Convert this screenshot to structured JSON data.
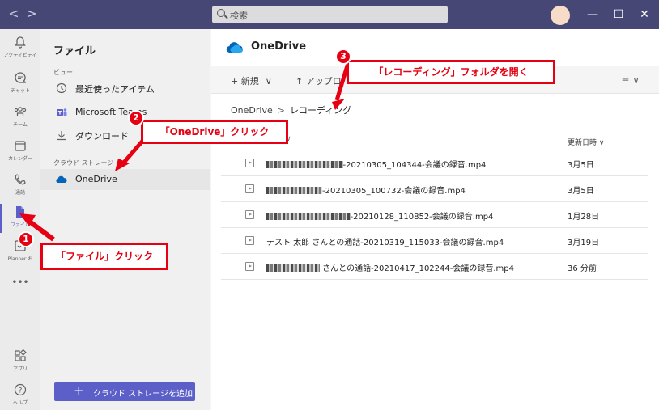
{
  "titlebar": {
    "back_label": "<",
    "forward_label": ">",
    "search_placeholder": "検索",
    "minimize_label": "—",
    "maximize_label": "☐",
    "close_label": "✕"
  },
  "rail": {
    "items": [
      {
        "label": "アクティビティ",
        "icon": "bell-icon"
      },
      {
        "label": "チャット",
        "icon": "chat-icon"
      },
      {
        "label": "チーム",
        "icon": "teams-icon"
      },
      {
        "label": "カレンダー",
        "icon": "calendar-icon"
      },
      {
        "label": "通話",
        "icon": "phone-icon"
      },
      {
        "label": "ファイル",
        "icon": "file-icon"
      },
      {
        "label": "Planner お",
        "icon": "planner-icon"
      },
      {
        "label": "•••",
        "icon": "more-icon"
      },
      {
        "label": "アプリ",
        "icon": "apps-icon"
      },
      {
        "label": "ヘルプ",
        "icon": "help-icon"
      }
    ],
    "active_index": 5
  },
  "files_panel": {
    "title": "ファイル",
    "view_section": "ビュー",
    "view_items": [
      {
        "label": "最近使ったアイテム",
        "icon": "clock-icon"
      },
      {
        "label": "Microsoft Teams",
        "icon": "teams-logo-icon"
      },
      {
        "label": "ダウンロード",
        "icon": "download-icon"
      }
    ],
    "cloud_section": "クラウド ストレージ",
    "cloud_items": [
      {
        "label": "OneDrive",
        "icon": "onedrive-icon"
      }
    ],
    "add_storage_label": "クラウド ストレージを追加"
  },
  "main": {
    "title": "OneDrive",
    "toolbar": {
      "new_label": "新規",
      "upload_label": "アップロ"
    },
    "breadcrumb": {
      "root": "OneDrive",
      "separator": ">",
      "current": "レコーディング"
    },
    "columns": {
      "type": "∨",
      "modified": "更新日時"
    },
    "files": [
      {
        "name": "-20210305_104344-会議の録音.mp4",
        "modified": "3月5日",
        "blur": 126
      },
      {
        "name": "-20210305_100732-会議の録音.mp4",
        "modified": "3月5日",
        "blur": 92
      },
      {
        "name": "-20210128_110852-会議の録音.mp4",
        "modified": "1月28日",
        "blur": 138
      },
      {
        "name": "テスト 太郎 さんとの通話-20210319_115033-会議の録音.mp4",
        "modified": "3月19日",
        "blur": 0
      },
      {
        "name": " さんとの通話-20210417_102244-会議の録音.mp4",
        "modified": "36 分前",
        "blur": 88
      }
    ]
  },
  "annotations": {
    "step1": {
      "number": "1",
      "text": "「ファイル」クリック"
    },
    "step2": {
      "number": "2",
      "text": "「OneDrive」クリック"
    },
    "step3": {
      "number": "3",
      "text": "「レコーディング」フォルダを開く"
    },
    "color": "#e60012"
  },
  "colors": {
    "titlebar": "#464775",
    "accent": "#5b5fc7",
    "onedrive_blue": "#0364b8"
  }
}
